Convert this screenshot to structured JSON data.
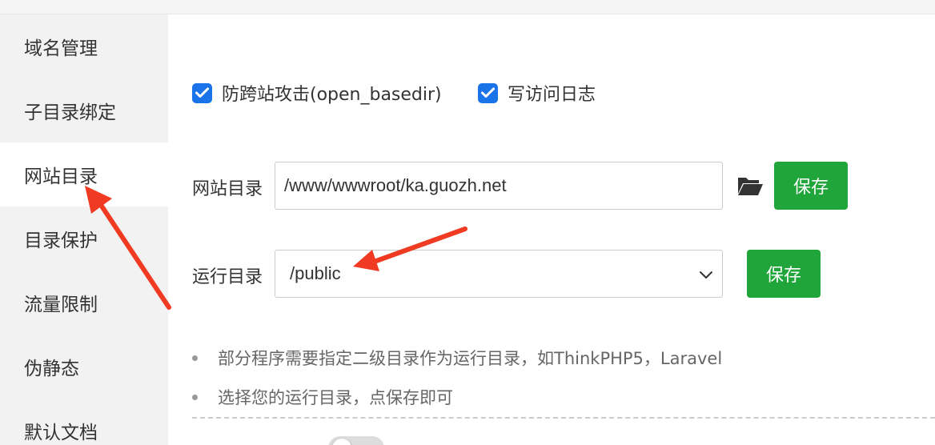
{
  "sidebar": {
    "items": [
      {
        "label": "域名管理",
        "active": false
      },
      {
        "label": "子目录绑定",
        "active": false
      },
      {
        "label": "网站目录",
        "active": true
      },
      {
        "label": "目录保护",
        "active": false
      },
      {
        "label": "流量限制",
        "active": false
      },
      {
        "label": "伪静态",
        "active": false
      },
      {
        "label": "默认文档",
        "active": false
      }
    ]
  },
  "options": {
    "anti_xss": {
      "label": "防跨站攻击(open_basedir)",
      "checked": true
    },
    "access_log": {
      "label": "写访问日志",
      "checked": true
    }
  },
  "site_dir": {
    "label": "网站目录",
    "value": "/www/wwwroot/ka.guozh.net",
    "save_label": "保存",
    "browse_icon": "folder-open-icon"
  },
  "run_dir": {
    "label": "运行目录",
    "selected": "/public",
    "save_label": "保存"
  },
  "tips": [
    "部分程序需要指定二级目录作为运行目录，如ThinkPHP5，Laravel",
    "选择您的运行目录，点保存即可"
  ],
  "colors": {
    "accent_green": "#20a53a",
    "checkbox_blue": "#1a73e8",
    "annotation_red": "#f03a22",
    "sidebar_bg": "#f2f2f2"
  }
}
